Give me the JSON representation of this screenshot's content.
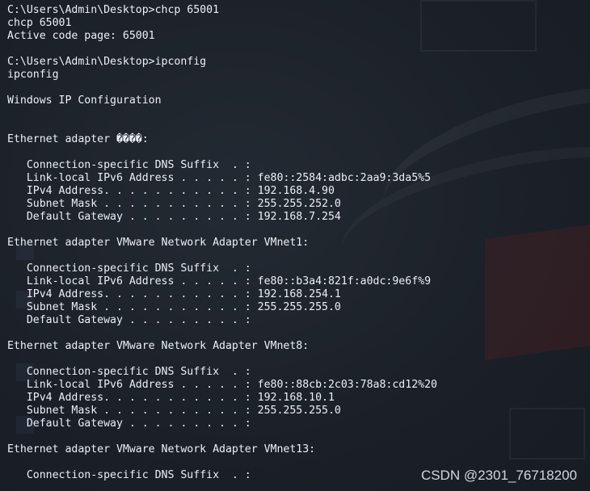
{
  "colors": {
    "background": "#1c2129",
    "foreground": "#eceff4"
  },
  "terminal": {
    "lines": [
      "C:\\Users\\Admin\\Desktop>chcp 65001",
      "chcp 65001",
      "Active code page: 65001",
      "",
      "C:\\Users\\Admin\\Desktop>ipconfig",
      "ipconfig",
      "",
      "Windows IP Configuration",
      "",
      "",
      "Ethernet adapter ����:",
      "",
      "   Connection-specific DNS Suffix  . :",
      "   Link-local IPv6 Address . . . . . : fe80::2584:adbc:2aa9:3da5%5",
      "   IPv4 Address. . . . . . . . . . . : 192.168.4.90",
      "   Subnet Mask . . . . . . . . . . . : 255.255.252.0",
      "   Default Gateway . . . . . . . . . : 192.168.7.254",
      "",
      "Ethernet adapter VMware Network Adapter VMnet1:",
      "",
      "   Connection-specific DNS Suffix  . :",
      "   Link-local IPv6 Address . . . . . : fe80::b3a4:821f:a0dc:9e6f%9",
      "   IPv4 Address. . . . . . . . . . . : 192.168.254.1",
      "   Subnet Mask . . . . . . . . . . . : 255.255.255.0",
      "   Default Gateway . . . . . . . . . :",
      "",
      "Ethernet adapter VMware Network Adapter VMnet8:",
      "",
      "   Connection-specific DNS Suffix  . :",
      "   Link-local IPv6 Address . . . . . : fe80::88cb:2c03:78a8:cd12%20",
      "   IPv4 Address. . . . . . . . . . . : 192.168.10.1",
      "   Subnet Mask . . . . . . . . . . . : 255.255.255.0",
      "   Default Gateway . . . . . . . . . :",
      "",
      "Ethernet adapter VMware Network Adapter VMnet13:",
      "",
      "   Connection-specific DNS Suffix  . :"
    ]
  },
  "watermark": {
    "text": "CSDN @2301_76718200"
  }
}
